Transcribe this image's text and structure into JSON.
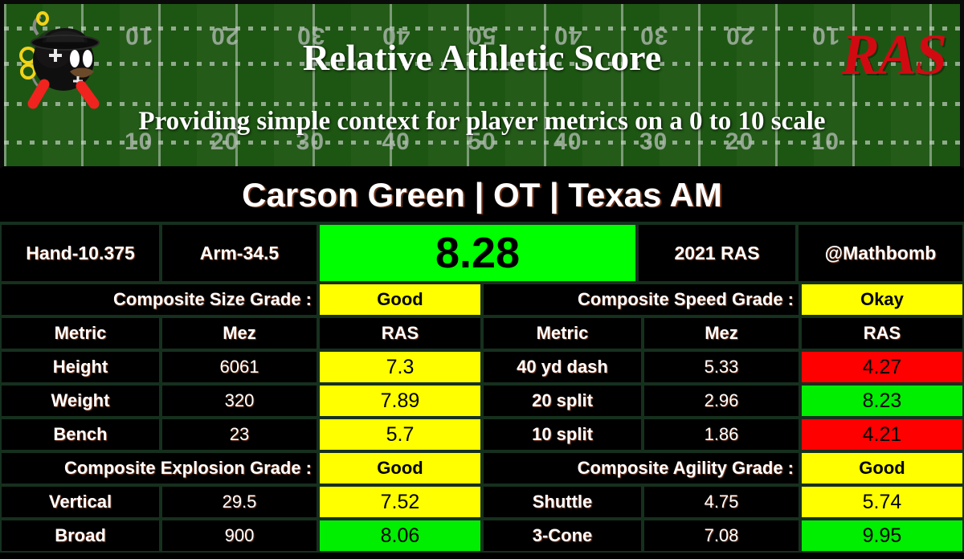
{
  "header": {
    "title": "Relative Athletic Score",
    "subtitle": "Providing simple context for player metrics on a 0 to 10 scale",
    "logo_text": "RAS",
    "logo_color": "#d10a12",
    "field_color": "#1d5612",
    "yard_numbers_top": [
      "10",
      "20",
      "30",
      "40",
      "50",
      "40",
      "30",
      "20",
      "10"
    ],
    "yard_numbers_bottom": [
      "10",
      "20",
      "30",
      "40",
      "50",
      "40",
      "30",
      "20",
      "10"
    ],
    "mascot_name": "bomb-mascot-icon"
  },
  "player": {
    "name_line": "Carson Green | OT | Texas AM"
  },
  "score_row": {
    "hand": "Hand-10.375",
    "arm": "Arm-34.5",
    "score": "8.28",
    "score_color": "#00ff00",
    "year_ras": "2021 RAS",
    "handle": "@Mathbomb"
  },
  "columns": {
    "metric": "Metric",
    "mez": "Mez",
    "ras": "RAS"
  },
  "sections": [
    {
      "grade_label": "Composite Size Grade :",
      "grade_value": "Good",
      "grade_color": "yellow",
      "rows": [
        {
          "metric": "Height",
          "mez": "6061",
          "ras": "7.3",
          "color": "yellow"
        },
        {
          "metric": "Weight",
          "mez": "320",
          "ras": "7.89",
          "color": "yellow"
        },
        {
          "metric": "Bench",
          "mez": "23",
          "ras": "5.7",
          "color": "yellow"
        }
      ]
    },
    {
      "grade_label": "Composite Speed Grade :",
      "grade_value": "Okay",
      "grade_color": "yellow",
      "rows": [
        {
          "metric": "40 yd dash",
          "mez": "5.33",
          "ras": "4.27",
          "color": "red"
        },
        {
          "metric": "20 split",
          "mez": "2.96",
          "ras": "8.23",
          "color": "green"
        },
        {
          "metric": "10 split",
          "mez": "1.86",
          "ras": "4.21",
          "color": "red"
        }
      ]
    },
    {
      "grade_label": "Composite Explosion Grade :",
      "grade_value": "Good",
      "grade_color": "yellow",
      "rows": [
        {
          "metric": "Vertical",
          "mez": "29.5",
          "ras": "7.52",
          "color": "yellow"
        },
        {
          "metric": "Broad",
          "mez": "900",
          "ras": "8.06",
          "color": "green"
        }
      ]
    },
    {
      "grade_label": "Composite Agility Grade :",
      "grade_value": "Good",
      "grade_color": "yellow",
      "rows": [
        {
          "metric": "Shuttle",
          "mez": "4.75",
          "ras": "5.74",
          "color": "yellow"
        },
        {
          "metric": "3-Cone",
          "mez": "7.08",
          "ras": "9.95",
          "color": "green"
        }
      ]
    }
  ],
  "palette": {
    "yellow": "#ffff00",
    "green": "#00ee00",
    "red": "#ff0000",
    "black": "#000000",
    "border": "#16301e"
  }
}
